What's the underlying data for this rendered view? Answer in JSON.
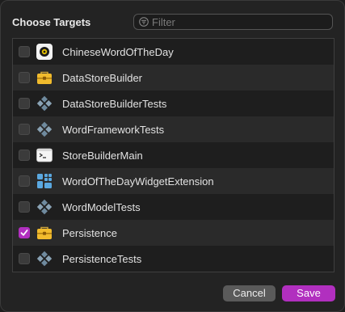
{
  "dialog": {
    "title": "Choose Targets",
    "filter": {
      "placeholder": "Filter",
      "value": ""
    },
    "targets": [
      {
        "name": "ChineseWordOfTheDay",
        "checked": false,
        "icon": "app-icon"
      },
      {
        "name": "DataStoreBuilder",
        "checked": false,
        "icon": "toolbox-icon"
      },
      {
        "name": "DataStoreBuilderTests",
        "checked": false,
        "icon": "test-diamond-icon"
      },
      {
        "name": "WordFrameworkTests",
        "checked": false,
        "icon": "test-diamond-icon"
      },
      {
        "name": "StoreBuilderMain",
        "checked": false,
        "icon": "terminal-icon"
      },
      {
        "name": "WordOfTheDayWidgetExtension",
        "checked": false,
        "icon": "widget-extension-icon"
      },
      {
        "name": "WordModelTests",
        "checked": false,
        "icon": "test-diamond-icon"
      },
      {
        "name": "Persistence",
        "checked": true,
        "icon": "toolbox-icon"
      },
      {
        "name": "PersistenceTests",
        "checked": false,
        "icon": "test-diamond-icon"
      }
    ],
    "buttons": {
      "cancel": "Cancel",
      "save": "Save"
    },
    "colors": {
      "accent": "#b12fbf",
      "background": "#232323"
    }
  }
}
